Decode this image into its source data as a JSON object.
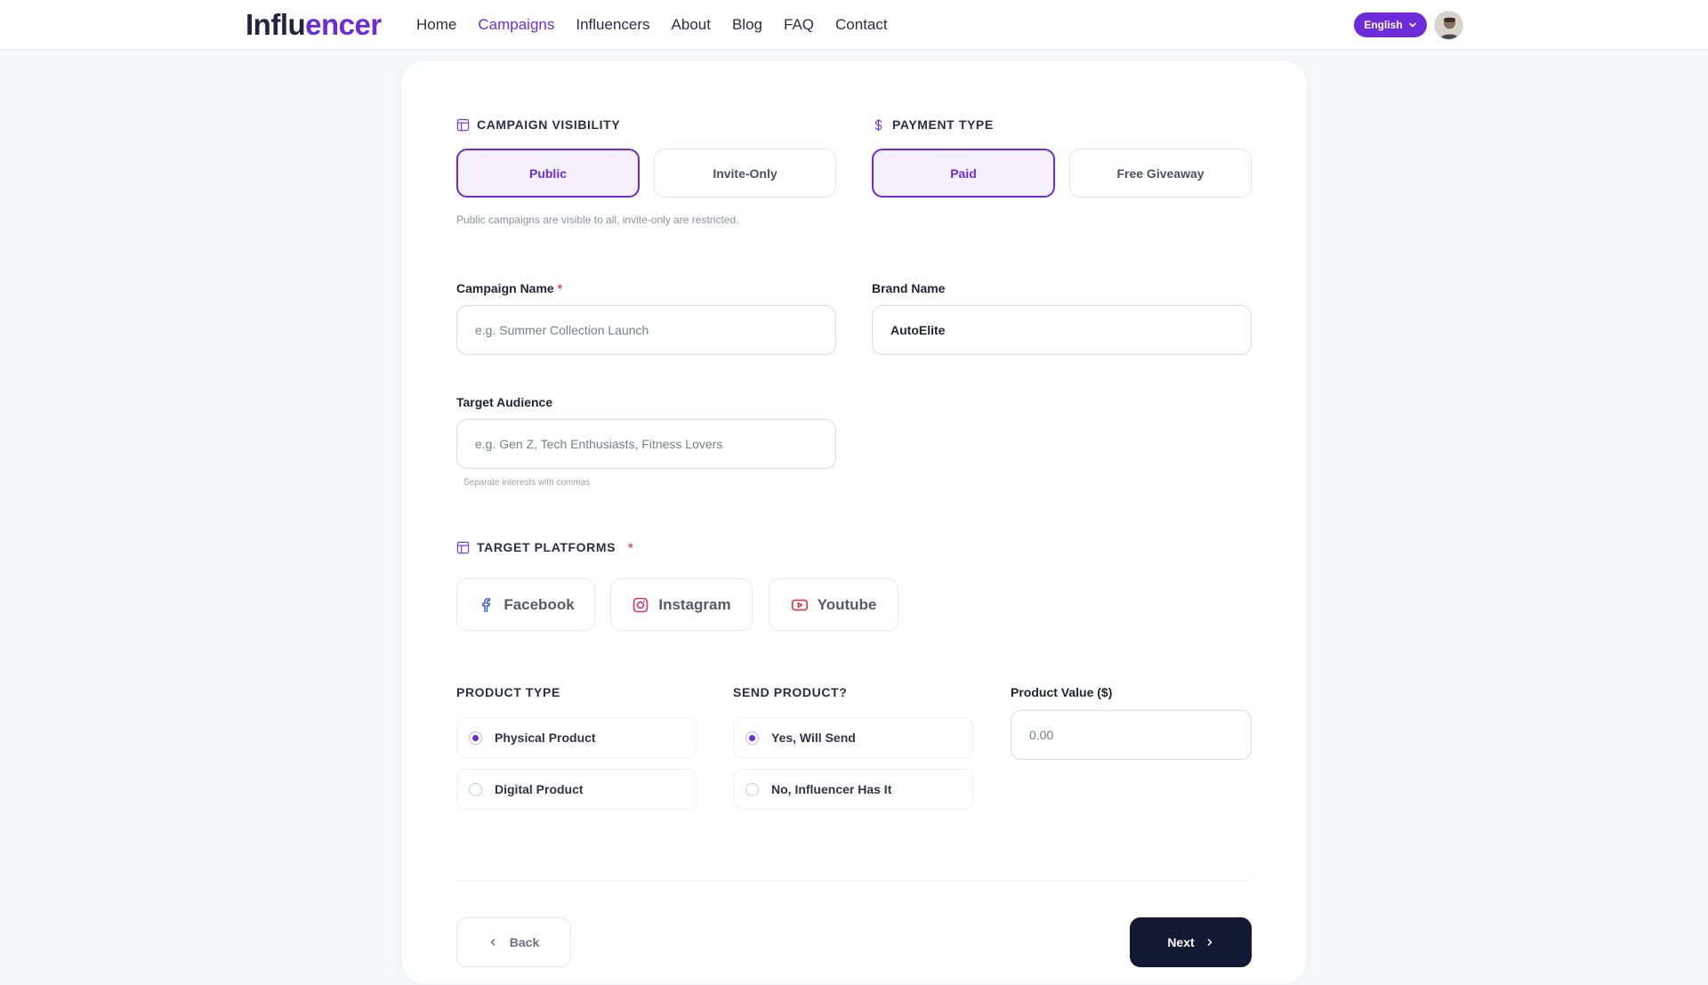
{
  "header": {
    "logo_part1": "Influ",
    "logo_part2": "encer",
    "nav": [
      "Home",
      "Campaigns",
      "Influencers",
      "About",
      "Blog",
      "FAQ",
      "Contact"
    ],
    "active_nav": "Campaigns",
    "language": "English"
  },
  "visibility": {
    "title": "CAMPAIGN VISIBILITY",
    "options": [
      "Public",
      "Invite-Only"
    ],
    "selected": "Public",
    "hint": "Public campaigns are visible to all, invite-only are restricted."
  },
  "payment": {
    "title": "PAYMENT TYPE",
    "options": [
      "Paid",
      "Free Giveaway"
    ],
    "selected": "Paid"
  },
  "campaign_name": {
    "label": "Campaign Name",
    "required_mark": "*",
    "value": "",
    "placeholder": "e.g. Summer Collection Launch"
  },
  "brand_name": {
    "label": "Brand Name",
    "value": "AutoElite",
    "placeholder": ""
  },
  "target_audience": {
    "label": "Target Audience",
    "value": "",
    "placeholder": "e.g. Gen Z, Tech Enthusiasts, Fitness Lovers",
    "hint": "Separate interests with commas"
  },
  "platforms": {
    "title": "TARGET PLATFORMS",
    "required_mark": "*",
    "items": [
      {
        "label": "Facebook",
        "icon": "facebook-icon"
      },
      {
        "label": "Instagram",
        "icon": "instagram-icon"
      },
      {
        "label": "Youtube",
        "icon": "youtube-icon"
      }
    ]
  },
  "product_type": {
    "title": "PRODUCT TYPE",
    "options": [
      "Physical Product",
      "Digital Product"
    ],
    "selected": "Physical Product"
  },
  "send_product": {
    "title": "SEND PRODUCT?",
    "options": [
      "Yes, Will Send",
      "No, Influencer Has It"
    ],
    "selected": "Yes, Will Send"
  },
  "product_value": {
    "label": "Product Value ($)",
    "value": "",
    "placeholder": "0.00"
  },
  "footer": {
    "back_label": "Back",
    "next_label": "Next"
  },
  "colors": {
    "accent": "#6d2bd9",
    "dark_button": "#121a33",
    "required": "#e04a5f"
  }
}
